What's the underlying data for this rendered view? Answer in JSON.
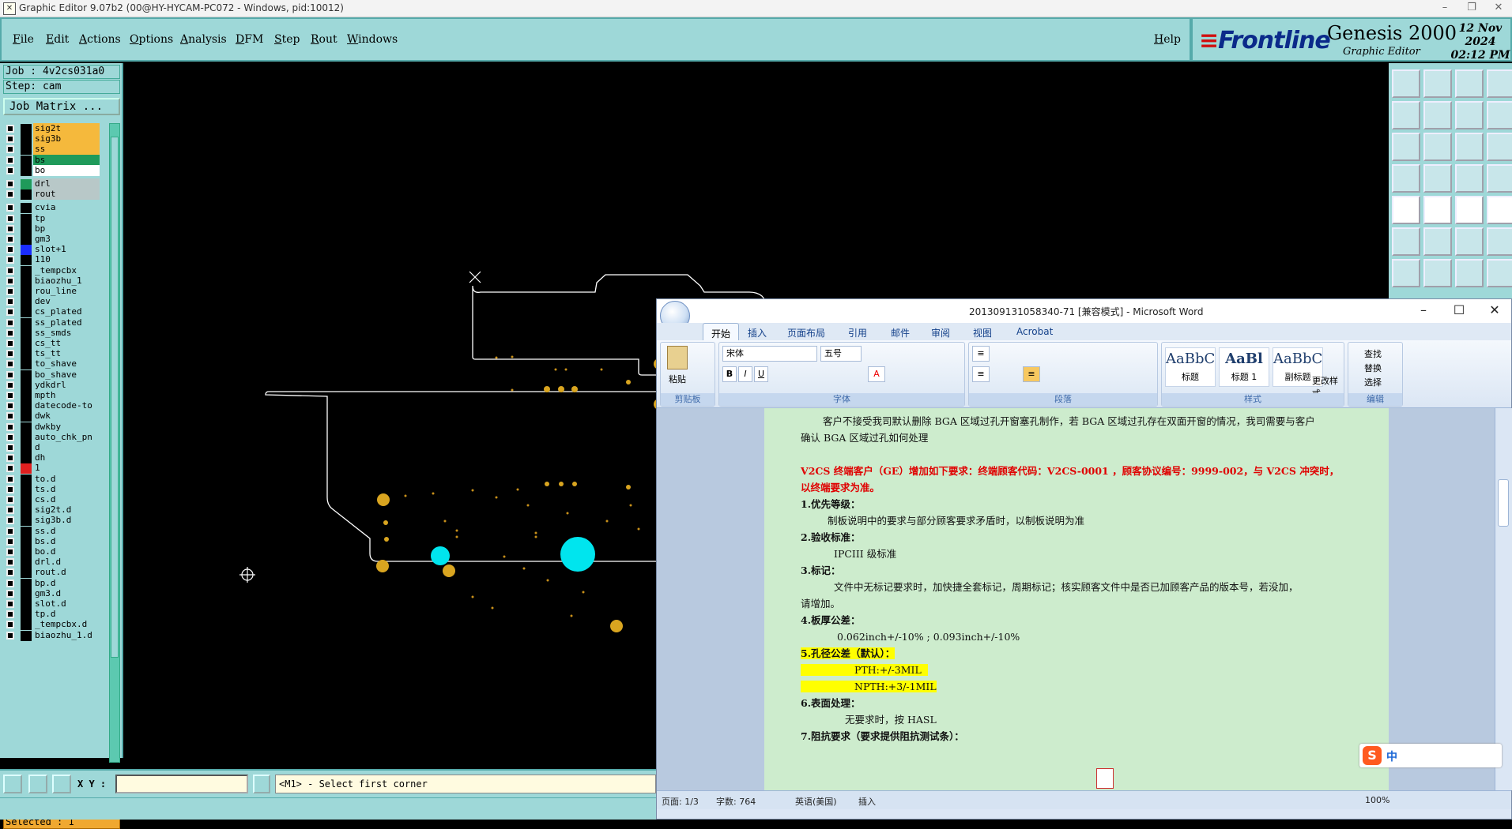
{
  "window": {
    "title": "Graphic Editor 9.07b2 (00@HY-HYCAM-PC072 - Windows, pid:10012)"
  },
  "menu": [
    "File",
    "Edit",
    "Actions",
    "Options",
    "Analysis",
    "DFM",
    "Step",
    "Rout",
    "Windows"
  ],
  "help_label": "Help",
  "brand": {
    "logo": "Frontline",
    "product": "Genesis 2000",
    "subtitle": "Graphic Editor",
    "date": "12 Nov 2024",
    "time": "02:12 PM"
  },
  "job": {
    "job_line": "Job : 4v2cs031a0",
    "step_line": "Step: cam",
    "matrix_button": "Job Matrix ..."
  },
  "layers": [
    {
      "name": "sig2t",
      "color": "#f5b93c",
      "swatch": "#000"
    },
    {
      "name": "sig3b",
      "color": "#f5b93c",
      "swatch": "#000"
    },
    {
      "name": "ss",
      "color": "#f5b93c",
      "swatch": "#000"
    },
    {
      "name": "bs",
      "color": "#1f9a5a",
      "swatch": "#000"
    },
    {
      "name": "bo",
      "color": "#ffffff",
      "swatch": "#000"
    },
    {
      "name": "drl",
      "color": "#b8c8c8",
      "swatch": "#1f9a5a"
    },
    {
      "name": "rout",
      "color": "#b8c8c8",
      "swatch": "#000"
    },
    {
      "name": "cvia",
      "color": "#9ed8d8",
      "swatch": "#000"
    },
    {
      "name": "tp",
      "color": "#9ed8d8",
      "swatch": "#000"
    },
    {
      "name": "bp",
      "color": "#9ed8d8",
      "swatch": "#000"
    },
    {
      "name": "gm3",
      "color": "#9ed8d8",
      "swatch": "#000"
    },
    {
      "name": "slot+1",
      "color": "#9ed8d8",
      "swatch": "#1a2cff"
    },
    {
      "name": "110",
      "color": "#9ed8d8",
      "swatch": "#000"
    },
    {
      "name": "_tempcbx",
      "color": "#9ed8d8",
      "swatch": "#000"
    },
    {
      "name": "biaozhu_1",
      "color": "#9ed8d8",
      "swatch": "#000"
    },
    {
      "name": "rou_line",
      "color": "#9ed8d8",
      "swatch": "#000"
    },
    {
      "name": "dev",
      "color": "#9ed8d8",
      "swatch": "#000"
    },
    {
      "name": "cs_plated",
      "color": "#9ed8d8",
      "swatch": "#000"
    },
    {
      "name": "ss_plated",
      "color": "#9ed8d8",
      "swatch": "#000"
    },
    {
      "name": "ss_smds",
      "color": "#9ed8d8",
      "swatch": "#000"
    },
    {
      "name": "cs_tt",
      "color": "#9ed8d8",
      "swatch": "#000"
    },
    {
      "name": "ts_tt",
      "color": "#9ed8d8",
      "swatch": "#000"
    },
    {
      "name": "to_shave",
      "color": "#9ed8d8",
      "swatch": "#000"
    },
    {
      "name": "bo_shave",
      "color": "#9ed8d8",
      "swatch": "#000"
    },
    {
      "name": "ydkdrl",
      "color": "#9ed8d8",
      "swatch": "#000"
    },
    {
      "name": "mpth",
      "color": "#9ed8d8",
      "swatch": "#000"
    },
    {
      "name": "datecode-to",
      "color": "#9ed8d8",
      "swatch": "#000"
    },
    {
      "name": "dwk",
      "color": "#9ed8d8",
      "swatch": "#000"
    },
    {
      "name": "dwkby",
      "color": "#9ed8d8",
      "swatch": "#000"
    },
    {
      "name": "auto_chk_pn",
      "color": "#9ed8d8",
      "swatch": "#000"
    },
    {
      "name": "d",
      "color": "#9ed8d8",
      "swatch": "#000"
    },
    {
      "name": "dh",
      "color": "#9ed8d8",
      "swatch": "#000"
    },
    {
      "name": "1",
      "color": "#9ed8d8",
      "swatch": "#e02020"
    },
    {
      "name": "to.d",
      "color": "#9ed8d8",
      "swatch": "#000"
    },
    {
      "name": "ts.d",
      "color": "#9ed8d8",
      "swatch": "#000"
    },
    {
      "name": "cs.d",
      "color": "#9ed8d8",
      "swatch": "#000"
    },
    {
      "name": "sig2t.d",
      "color": "#9ed8d8",
      "swatch": "#000"
    },
    {
      "name": "sig3b.d",
      "color": "#9ed8d8",
      "swatch": "#000"
    },
    {
      "name": "ss.d",
      "color": "#9ed8d8",
      "swatch": "#000"
    },
    {
      "name": "bs.d",
      "color": "#9ed8d8",
      "swatch": "#000"
    },
    {
      "name": "bo.d",
      "color": "#9ed8d8",
      "swatch": "#000"
    },
    {
      "name": "drl.d",
      "color": "#9ed8d8",
      "swatch": "#000"
    },
    {
      "name": "rout.d",
      "color": "#9ed8d8",
      "swatch": "#000"
    },
    {
      "name": "bp.d",
      "color": "#9ed8d8",
      "swatch": "#000"
    },
    {
      "name": "gm3.d",
      "color": "#9ed8d8",
      "swatch": "#000"
    },
    {
      "name": "slot.d",
      "color": "#9ed8d8",
      "swatch": "#000"
    },
    {
      "name": "tp.d",
      "color": "#9ed8d8",
      "swatch": "#000"
    },
    {
      "name": "_tempcbx.d",
      "color": "#9ed8d8",
      "swatch": "#000"
    },
    {
      "name": "biaozhu_1.d",
      "color": "#9ed8d8",
      "swatch": "#000"
    }
  ],
  "selected": "Selected : 1",
  "coords": {
    "label": "X Y :",
    "value": ""
  },
  "prompt": "<M1> - Select first corner",
  "word": {
    "title": "201309131058340-71 [兼容模式] - Microsoft Word",
    "tabs": [
      "开始",
      "插入",
      "页面布局",
      "引用",
      "邮件",
      "审阅",
      "视图",
      "Acrobat"
    ],
    "clipboard_label": "剪贴板",
    "paste_label": "粘贴",
    "font_name": "宋体",
    "font_size": "五号",
    "font_group": "字体",
    "paragraph_group": "段落",
    "styles_group": "样式",
    "editing_group": "编辑",
    "styles": [
      {
        "sample": "AaBbC",
        "name": "标题"
      },
      {
        "sample": "AaBl",
        "name": "标题 1"
      },
      {
        "sample": "AaBbC",
        "name": "副标题"
      }
    ],
    "change_styles": "更改样式",
    "find": "查找",
    "replace": "替换",
    "select": "选择",
    "doc": {
      "line1": "客户不接受我司默认删除 BGA 区域过孔开窗塞孔制作，若 BGA 区域过孔存在双面开窗的情况，我司需要与客户",
      "line2": "确认 BGA 区域过孔如何处理",
      "red1": "V2CS 终端客户（GE）增加如下要求：终端顾客代码：V2CS-0001  ，顾客协议编号：9999-002，与 V2CS 冲突时，",
      "red2": "以终端要求为准。",
      "h1": "1.优先等级：",
      "p1": "制板说明中的要求与部分顾客要求矛盾时，以制板说明为准",
      "h2": "2.验收标准：",
      "p2": "IPCIII 级标准",
      "h3": "3.标记：",
      "p3a": "文件中无标记要求时，加快捷全套标记，周期标记；核实顾客文件中是否已加顾客产品的版本号，若没加，",
      "p3b": "请增加。",
      "h4": "4.板厚公差：",
      "p4": "0.062inch+/-10% ; 0.093inch+/-10%",
      "h5": "5.孔径公差（默认）：",
      "p5a": "PTH:+/-3MIL",
      "p5b": "NPTH:+3/-1MIL",
      "h6": "6.表面处理：",
      "p6": "无要求时，按 HASL",
      "h7": "7.阻抗要求（要求提供阻抗测试条）："
    },
    "status": {
      "page": "页面: 1/3",
      "words": "字数: 764",
      "lang": "英语(美国)",
      "mode": "插入",
      "zoom": "100%"
    }
  },
  "ime": {
    "label": "中"
  }
}
